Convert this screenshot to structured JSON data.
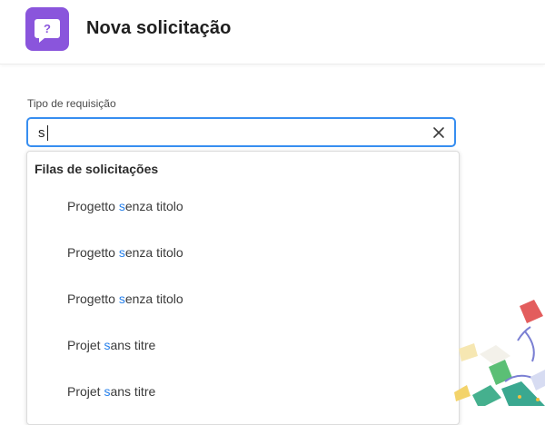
{
  "header": {
    "title": "Nova solicitação",
    "icon": "request-chat-icon",
    "icon_color": "#8a55dc",
    "icon_glyph": "?"
  },
  "field": {
    "label": "Tipo de requisição",
    "value": "s",
    "accent_color": "#378ef0"
  },
  "dropdown": {
    "group_label": "Filas de solicitações",
    "options": [
      {
        "before": "Progetto ",
        "match": "s",
        "after": "enza titolo"
      },
      {
        "before": "Progetto ",
        "match": "s",
        "after": "enza titolo"
      },
      {
        "before": "Progetto ",
        "match": "s",
        "after": "enza titolo"
      },
      {
        "before": "Projet ",
        "match": "s",
        "after": "ans titre"
      },
      {
        "before": "Projet ",
        "match": "s",
        "after": "ans titre"
      }
    ],
    "highlight_color": "#2680eb"
  }
}
